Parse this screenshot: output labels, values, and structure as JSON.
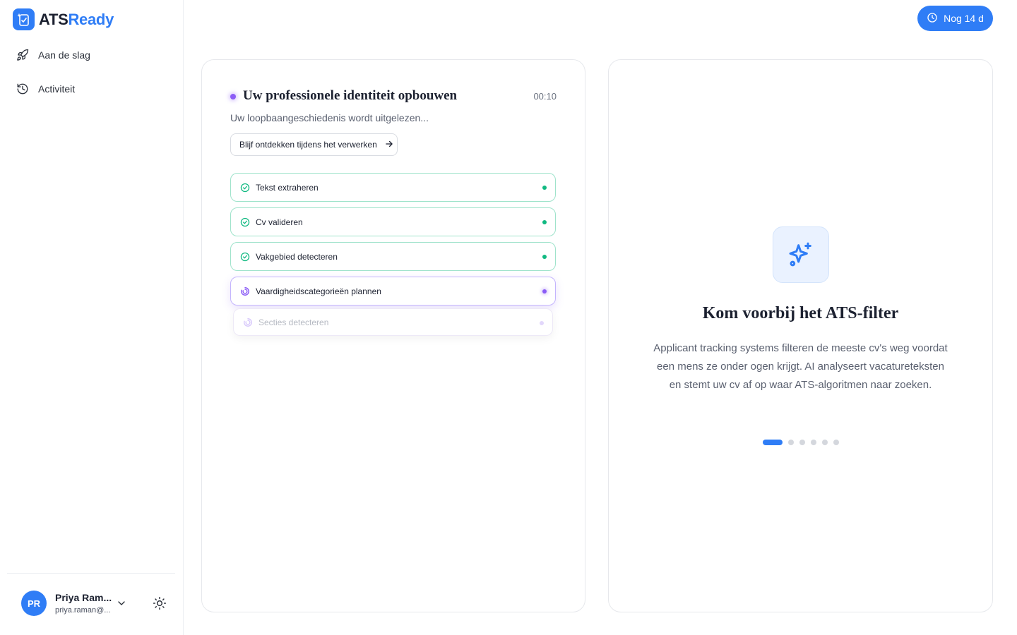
{
  "app": {
    "brand_part1": "ATS",
    "brand_part2": "Ready",
    "brand_color": "#2f7df6"
  },
  "sidebar": {
    "items": [
      {
        "label": "Aan de slag",
        "icon": "rocket-icon"
      },
      {
        "label": "Activiteit",
        "icon": "history-icon"
      }
    ],
    "user": {
      "initials": "PR",
      "name": "Priya Ram...",
      "email": "priya.raman@..."
    }
  },
  "header": {
    "trial_label": "Nog 14 d"
  },
  "processing": {
    "title": "Uw professionele identiteit opbouwen",
    "timer": "00:10",
    "subtitle": "Uw loopbaangeschiedenis wordt uitgelezen...",
    "discover_button": "Blijf ontdekken tijdens het verwerken",
    "steps": [
      {
        "label": "Tekst extraheren",
        "status": "done"
      },
      {
        "label": "Cv valideren",
        "status": "done"
      },
      {
        "label": "Vakgebied detecteren",
        "status": "done"
      },
      {
        "label": "Vaardigheidscategorieën plannen",
        "status": "active"
      },
      {
        "label": "Secties detecteren",
        "status": "pending"
      }
    ]
  },
  "feature": {
    "icon": "sparkles-icon",
    "title": "Kom voorbij het ATS-filter",
    "description": "Applicant tracking systems filteren de meeste cv's weg voordat een mens ze onder ogen krijgt. AI analyseert vacatureteksten en stemt uw cv af op waar ATS-algoritmen naar zoeken.",
    "carousel_total": 6,
    "carousel_active": 1
  }
}
